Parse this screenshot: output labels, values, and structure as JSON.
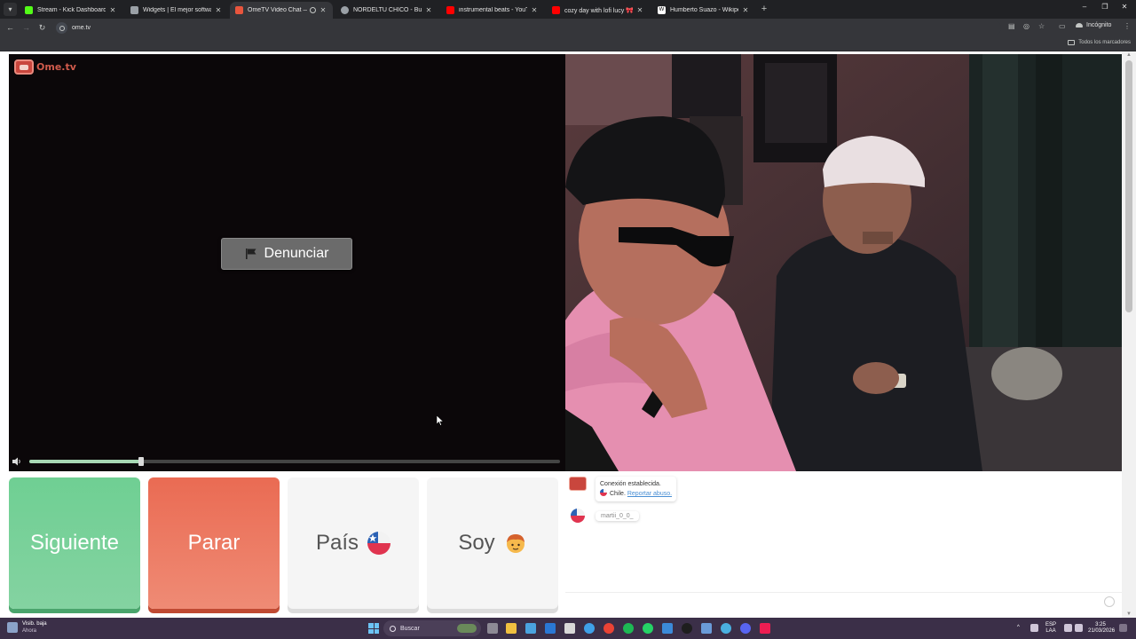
{
  "browser": {
    "tabs": [
      {
        "title": "Stream - Kick Dashboard",
        "favicon_color": "#53fc18",
        "active": false
      },
      {
        "title": "Widgets | El mejor software pa",
        "favicon_color": "#9aa0a6",
        "active": false
      },
      {
        "title": "OmeTV Video Chat — Ome",
        "favicon_color": "#e8553d",
        "active": true
      },
      {
        "title": "NORDELTU CHICO - Buscar con",
        "favicon_color": "#9aa0a6",
        "active": false
      },
      {
        "title": "instrumental beats - YouTube",
        "favicon_color": "#ff0000",
        "active": false
      },
      {
        "title": "cozy day with lofi lucy 🎀 beat",
        "favicon_color": "#ff0000",
        "active": false
      },
      {
        "title": "Humberto Suazo - Wikipedia, l",
        "favicon_color": "#ffffff",
        "active": false
      }
    ],
    "url": "ome.tv",
    "incognito_label": "Incógnito",
    "bookmarks_all_label": "Todos los marcadores"
  },
  "page": {
    "logo_text": "Ome.tv",
    "report_button_label": "Denunciar",
    "volume_level": 0.21,
    "buttons": {
      "next_label": "Siguiente",
      "stop_label": "Parar",
      "country_label": "País",
      "soy_label": "Soy"
    },
    "chat": {
      "system_message": "Conexión establecida.",
      "country": "Chile.",
      "report_link": "Reportar abuso.",
      "user_message": "martii_0_0_"
    }
  },
  "taskbar": {
    "weather_title": "Visib. baja",
    "weather_sub": "Ahora",
    "search_label": "Buscar",
    "lang_top": "ESP",
    "lang_bottom": "LAA",
    "time": "3:25",
    "date": "21/03/2026"
  },
  "colors": {
    "next": "#6fcf93",
    "stop": "#ea6b53",
    "accent_link": "#4a8fd4"
  }
}
